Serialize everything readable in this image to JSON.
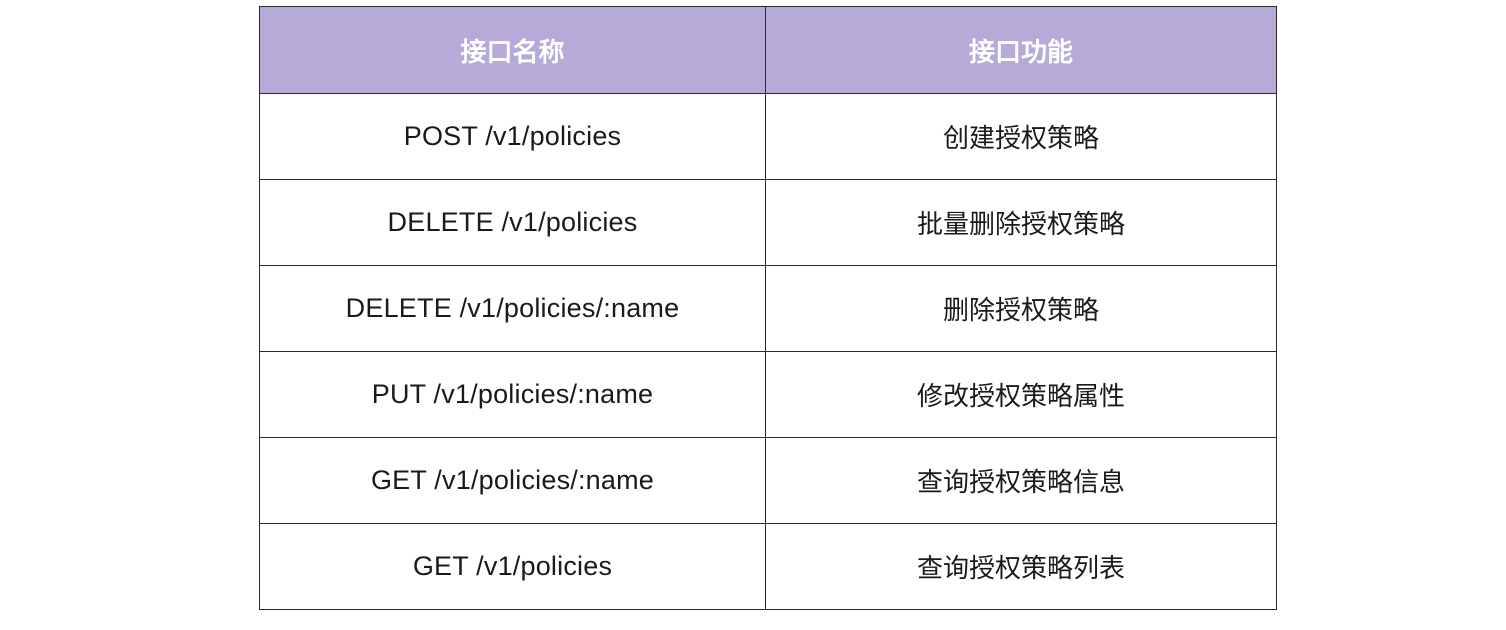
{
  "table": {
    "headers": [
      "接口名称",
      "接口功能"
    ],
    "rows": [
      [
        "POST /v1/policies",
        "创建授权策略"
      ],
      [
        "DELETE /v1/policies",
        "批量删除授权策略"
      ],
      [
        "DELETE /v1/policies/:name",
        "删除授权策略"
      ],
      [
        "PUT /v1/policies/:name",
        "修改授权策略属性"
      ],
      [
        "GET /v1/policies/:name",
        "查询授权策略信息"
      ],
      [
        "GET /v1/policies",
        "查询授权策略列表"
      ]
    ]
  },
  "colors": {
    "header_bg": "#b5aad8",
    "header_text": "#ffffff",
    "border": "#2b2b2b",
    "cell_text": "#1a1a1a"
  }
}
